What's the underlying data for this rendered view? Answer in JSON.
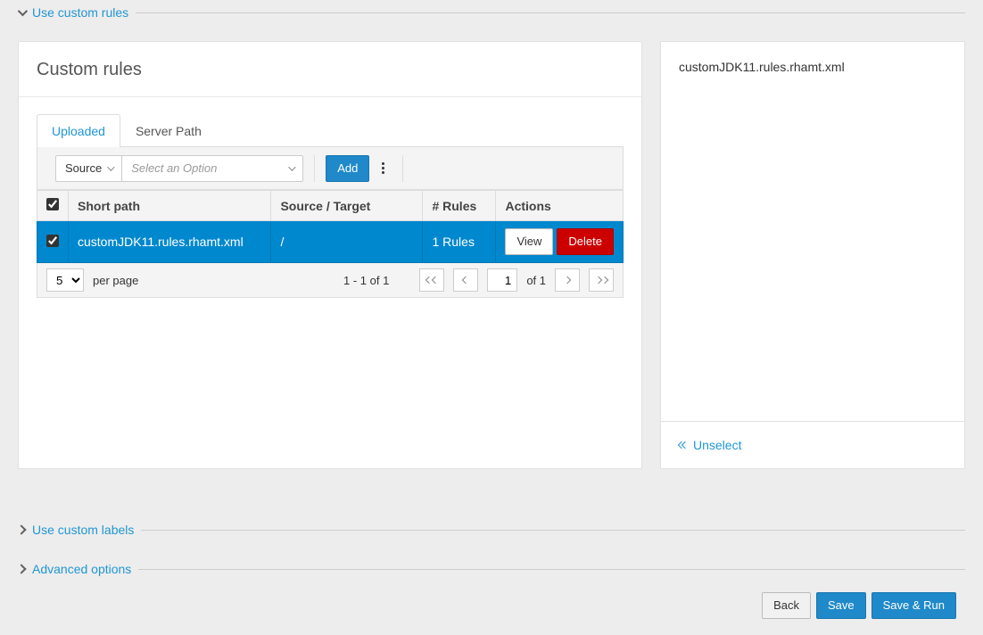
{
  "sections": {
    "customRules": "Use custom rules",
    "customLabels": "Use custom labels",
    "advanced": "Advanced options"
  },
  "panel": {
    "title": "Custom rules",
    "tabs": {
      "uploaded": "Uploaded",
      "serverPath": "Server Path"
    },
    "filter": {
      "sourceLabel": "Source",
      "placeholder": "Select an Option",
      "addLabel": "Add"
    },
    "table": {
      "headers": {
        "shortPath": "Short path",
        "sourceTarget": "Source / Target",
        "rules": "# Rules",
        "actions": "Actions"
      },
      "rows": [
        {
          "shortPath": "customJDK11.rules.rhamt.xml",
          "sourceTarget": "/",
          "rules": "1 Rules",
          "view": "View",
          "delete": "Delete"
        }
      ]
    },
    "pager": {
      "perPageValue": "5",
      "perPageLabel": "per page",
      "range": "1 - 1 of  1",
      "page": "1",
      "ofTotal": "of 1"
    }
  },
  "right": {
    "filename": "customJDK11.rules.rhamt.xml",
    "unselect": "Unselect"
  },
  "footer": {
    "back": "Back",
    "save": "Save",
    "saveRun": "Save & Run"
  }
}
